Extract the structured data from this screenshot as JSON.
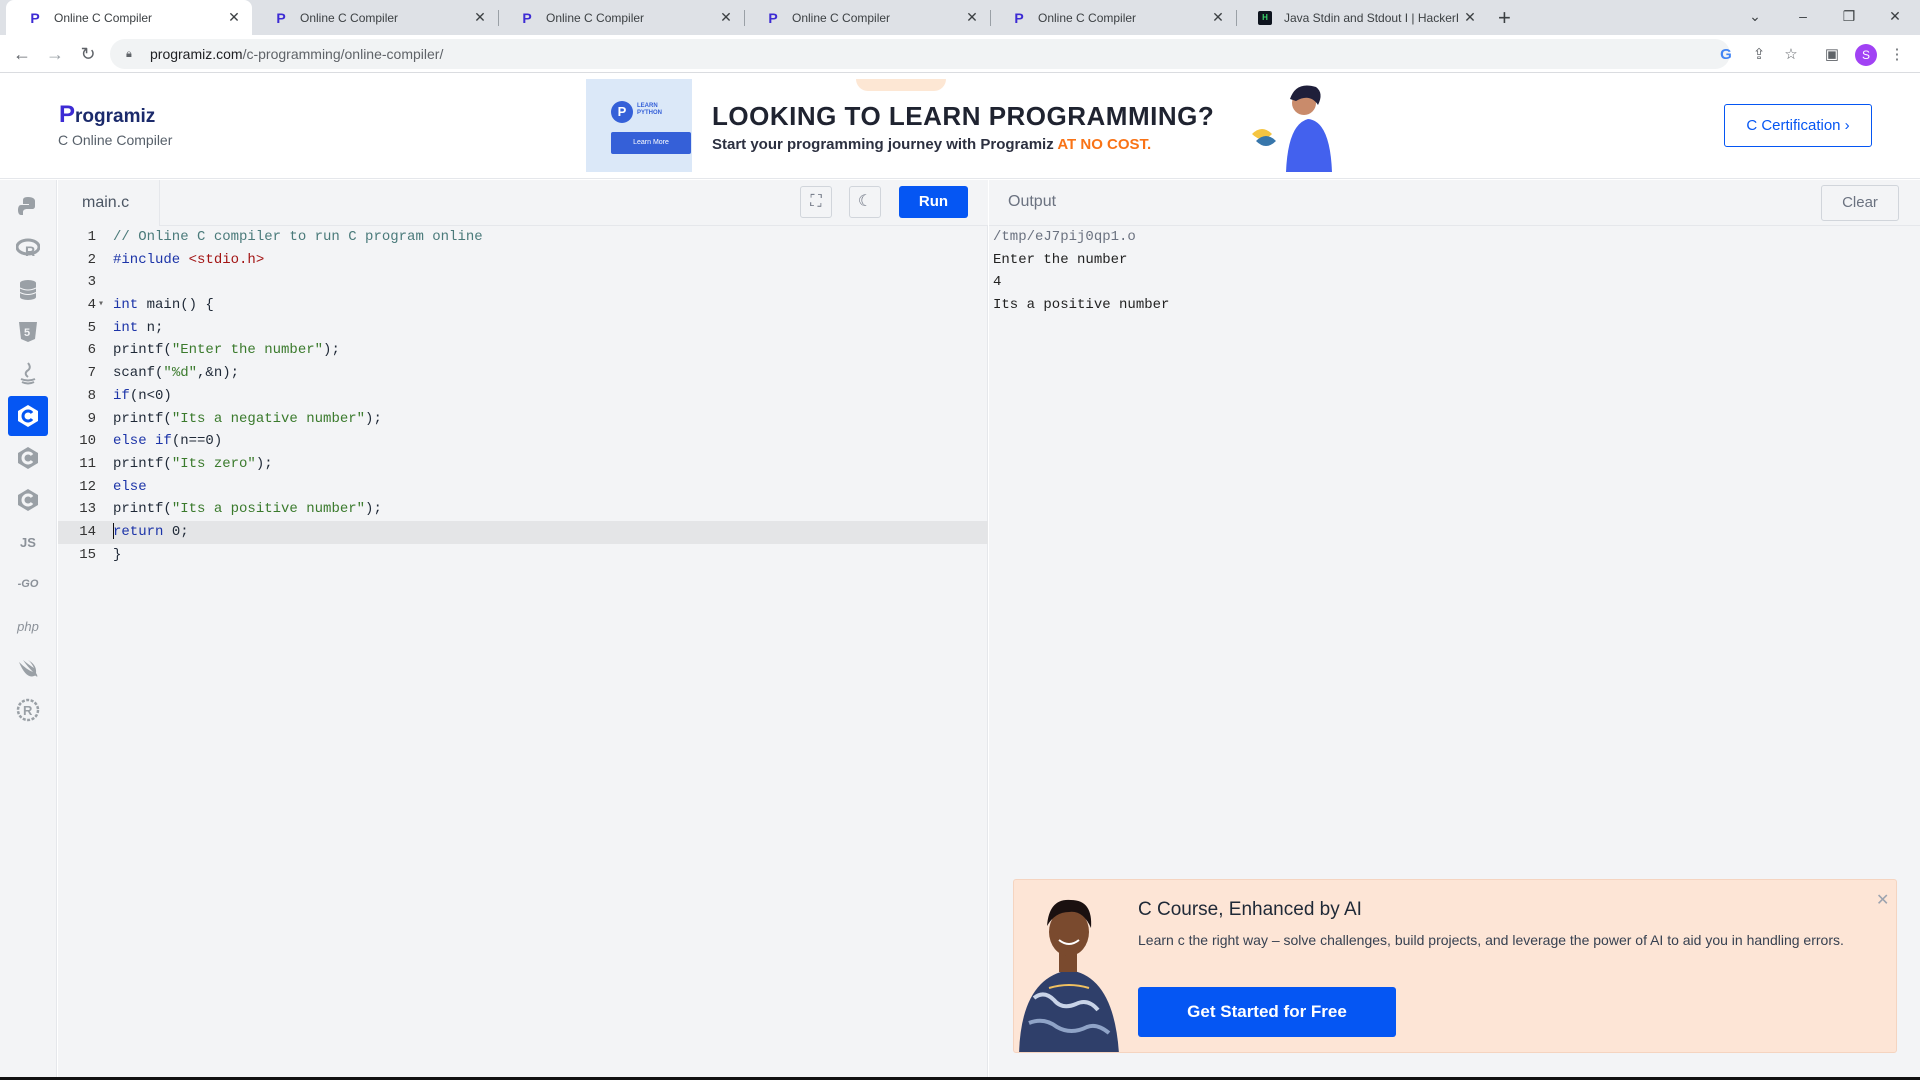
{
  "browser": {
    "tabs": [
      {
        "title": "Online C Compiler",
        "icon": "programiz-icon",
        "active": true
      },
      {
        "title": "Online C Compiler",
        "icon": "programiz-icon",
        "active": false
      },
      {
        "title": "Online C Compiler",
        "icon": "programiz-icon",
        "active": false
      },
      {
        "title": "Online C Compiler",
        "icon": "programiz-icon",
        "active": false
      },
      {
        "title": "Online C Compiler",
        "icon": "programiz-icon",
        "active": false
      },
      {
        "title": "Java Stdin and Stdout I | HackerR",
        "icon": "hackerrank-icon",
        "active": false
      }
    ],
    "url_host": "programiz.com",
    "url_path": "/c-programming/online-compiler/",
    "profile_initial": "S"
  },
  "header": {
    "logo_text": "rogramiz",
    "logo_letter": "P",
    "subtitle": "C Online Compiler",
    "certification_label": "C Certification ›"
  },
  "banner": {
    "tag_line1": "LEARN",
    "tag_line2": "PYTHON",
    "learn_more": "Learn More",
    "headline": "LOOKING TO LEARN PROGRAMMING?",
    "sub": "Start your programming journey with Programiz ",
    "sub_accent": "AT NO COST."
  },
  "sidebar": {
    "languages": [
      "python-icon",
      "r-icon",
      "sql-icon",
      "html-icon",
      "java-icon",
      "c-icon",
      "cpp-icon",
      "csharp-icon",
      "js-icon",
      "go-icon",
      "php-icon",
      "swift-icon",
      "rust-icon"
    ],
    "labels": {
      "js": "JS",
      "go": "-GO",
      "php": "php"
    }
  },
  "editor": {
    "filename": "main.c",
    "run_label": "Run",
    "lines": [
      {
        "n": "1",
        "text": "// Online C compiler to run C program online"
      },
      {
        "n": "2",
        "text": "#include <stdio.h>"
      },
      {
        "n": "3",
        "text": ""
      },
      {
        "n": "4",
        "text": "int main() {"
      },
      {
        "n": "5",
        "text": "int n;"
      },
      {
        "n": "6",
        "text": "printf(\"Enter the number\");"
      },
      {
        "n": "7",
        "text": "scanf(\"%d\",&n);"
      },
      {
        "n": "8",
        "text": "if(n<0)"
      },
      {
        "n": "9",
        "text": "printf(\"Its a negative number\");"
      },
      {
        "n": "10",
        "text": "else if(n==0)"
      },
      {
        "n": "11",
        "text": "printf(\"Its zero\");"
      },
      {
        "n": "12",
        "text": "else"
      },
      {
        "n": "13",
        "text": "printf(\"Its a positive number\");"
      },
      {
        "n": "14",
        "text": "return 0;"
      },
      {
        "n": "15",
        "text": "}"
      }
    ]
  },
  "output": {
    "title": "Output",
    "clear_label": "Clear",
    "lines": [
      "/tmp/eJ7pij0qp1.o",
      "Enter the number",
      "4",
      "Its a positive number"
    ]
  },
  "promo": {
    "title": "C Course, Enhanced by AI",
    "description": "Learn c the right way – solve challenges, build projects, and leverage the power of AI to aid you in handling errors.",
    "button_label": "Get Started for Free",
    "close_label": "✕"
  },
  "colors": {
    "brand": "#0556f3",
    "promo_bg": "#fde5d6",
    "accent_orange": "#f97316"
  }
}
